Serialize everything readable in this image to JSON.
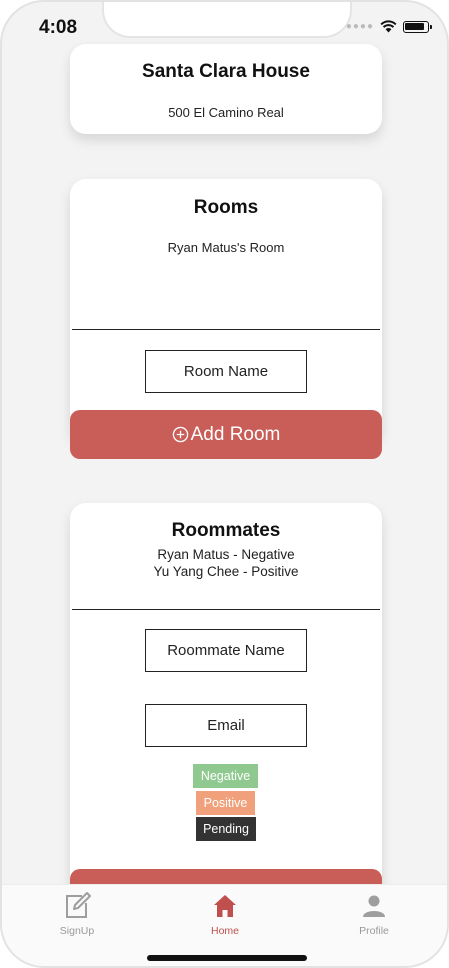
{
  "status_bar": {
    "time": "4:08"
  },
  "house": {
    "name": "Santa Clara House",
    "address": "500 El Camino Real"
  },
  "rooms": {
    "title": "Rooms",
    "items": [
      "Ryan Matus's Room"
    ],
    "input_placeholder": "Room Name",
    "add_button_label": "Add Room"
  },
  "roommates": {
    "title": "Roommates",
    "items": [
      "Ryan Matus - Negative",
      "Yu Yang Chee - Positive"
    ],
    "name_placeholder": "Roommate Name",
    "email_placeholder": "Email",
    "status_options": [
      {
        "label": "Negative",
        "color": "#8fc98f"
      },
      {
        "label": "Positive",
        "color": "#f0a07a"
      },
      {
        "label": "Pending",
        "color": "#333333"
      }
    ]
  },
  "tabs": [
    {
      "label": "SignUp",
      "icon": "edit-icon",
      "active": false
    },
    {
      "label": "Home",
      "icon": "home-icon",
      "active": true
    },
    {
      "label": "Profile",
      "icon": "person-icon",
      "active": false
    }
  ],
  "colors": {
    "accent": "#c95d57",
    "active_tab": "#c0504d",
    "inactive_tab": "#9e9e9e"
  }
}
